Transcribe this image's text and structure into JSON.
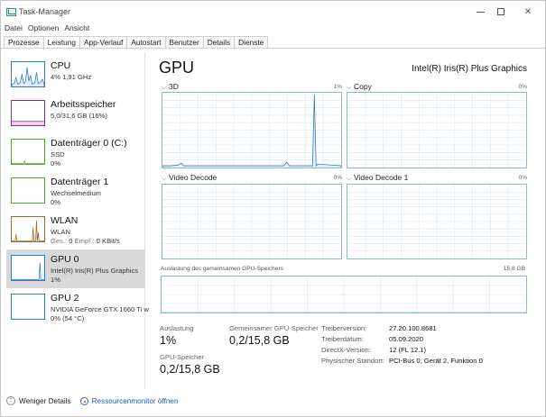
{
  "window": {
    "title": "Task-Manager"
  },
  "menu": [
    "Datei",
    "Optionen",
    "Ansicht"
  ],
  "tabs": [
    {
      "label": "Prozesse",
      "active": false
    },
    {
      "label": "Leistung",
      "active": true
    },
    {
      "label": "App-Verlauf",
      "active": false
    },
    {
      "label": "Autostart",
      "active": false
    },
    {
      "label": "Benutzer",
      "active": false
    },
    {
      "label": "Details",
      "active": false
    },
    {
      "label": "Dienste",
      "active": false
    }
  ],
  "sidebar": {
    "cpu": {
      "title": "CPU",
      "line1": "4% 1,91 GHz"
    },
    "memory": {
      "title": "Arbeitsspeicher",
      "line1": "5,0/31,6 GB (16%)"
    },
    "disk0": {
      "title": "Datenträger 0 (C:)",
      "line1": "SSD",
      "line2": "0%"
    },
    "disk1": {
      "title": "Datenträger 1",
      "line1": "Wechselmedium",
      "line2": "0%"
    },
    "wlan": {
      "title": "WLAN",
      "line1": "WLAN",
      "line2_a": "Ges.: ",
      "line2_b": "0 ",
      "line2_c": "Empf.: ",
      "line2_d": "0 KBit/s"
    },
    "gpu0": {
      "title": "GPU 0",
      "line1": "Intel(R) Iris(R) Plus Graphics",
      "line2": "1%"
    },
    "gpu2": {
      "title": "GPU 2",
      "line1": "NVIDIA GeForce GTX 1660 Ti w",
      "line2": "0% (54 °C)"
    }
  },
  "main": {
    "heading": "GPU",
    "model": "Intel(R) Iris(R) Plus Graphics",
    "graphs": [
      {
        "label": "3D",
        "percent": "1%"
      },
      {
        "label": "Copy",
        "percent": "0%"
      },
      {
        "label": "Video Decode",
        "percent": "0%"
      },
      {
        "label": "Video Decode 1",
        "percent": "0%"
      }
    ],
    "shared_mem_label": "Auslastung des gemeinsamen GPU-Speichers",
    "shared_mem_max": "15,8 GB"
  },
  "stats": {
    "utilization_label": "Auslastung",
    "utilization_value": "1%",
    "shared_label": "Gemeinsamer GPU-Speicher",
    "shared_value": "0,2/15,8 GB",
    "gpu_mem_label": "GPU-Speicher",
    "gpu_mem_value": "0,2/15,8 GB"
  },
  "properties": [
    {
      "key": "Treiberversion:",
      "value": "27.20.100.8681"
    },
    {
      "key": "Treiberdatum:",
      "value": "05.09.2020"
    },
    {
      "key": "DirectX-Version:",
      "value": "12 (FL 12.1)"
    },
    {
      "key": "Physischer Standort:",
      "value": "PCI-Bus 0, Gerät 2, Funktion 0"
    }
  ],
  "footer": {
    "fewer_details": "Weniger Details",
    "resource_monitor": "Ressourcenmonitor öffnen"
  },
  "colors": {
    "cpu": "#2b7bbf",
    "memory": "#8b2a8b",
    "disk": "#4ea72e",
    "wlan": "#a6692b",
    "gpu": "#2b7bbf",
    "graph_grid": "#d4e6f4",
    "selected_bg": "#d9d9d9",
    "link": "#1a5fb4"
  }
}
